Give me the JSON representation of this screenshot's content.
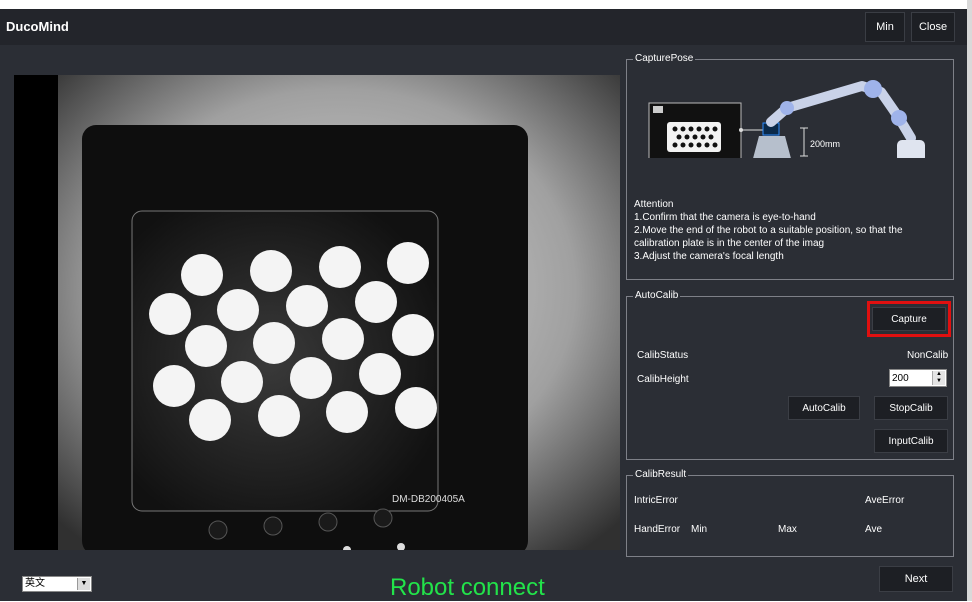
{
  "title": "DucoMind",
  "window_buttons": {
    "min": "Min",
    "close": "Close"
  },
  "camera": {
    "plate_label": "DM-DB200405A"
  },
  "capture_pose": {
    "title": "CapturePose",
    "diagram_distance": "200mm",
    "attention_title": "Attention",
    "attention_lines": [
      "1.Confirm that the camera is eye-to-hand",
      "2.Move the end of the robot to a suitable position, so that the calibration plate is in the center of the imag",
      "3.Adjust the camera's focal length"
    ]
  },
  "auto_calib": {
    "title": "AutoCalib",
    "capture_label": "Capture",
    "status_label": "CalibStatus",
    "status_value": "NonCalib",
    "height_label": "CalibHeight",
    "height_value": "200",
    "autocalib_label": "AutoCalib",
    "stopcalib_label": "StopCalib",
    "inputcalib_label": "InputCalib"
  },
  "calib_result": {
    "title": "CalibResult",
    "intric_error_label": "IntricError",
    "ave_error_label": "AveError",
    "hand_error_label": "HandError",
    "min_label": "Min",
    "max_label": "Max",
    "ave_label": "Ave"
  },
  "footer": {
    "language": "英文",
    "status": "Robot connect",
    "next_label": "Next"
  },
  "colors": {
    "background": "#2b2e35",
    "status_green": "#22e34a",
    "highlight_red": "#e01010"
  }
}
